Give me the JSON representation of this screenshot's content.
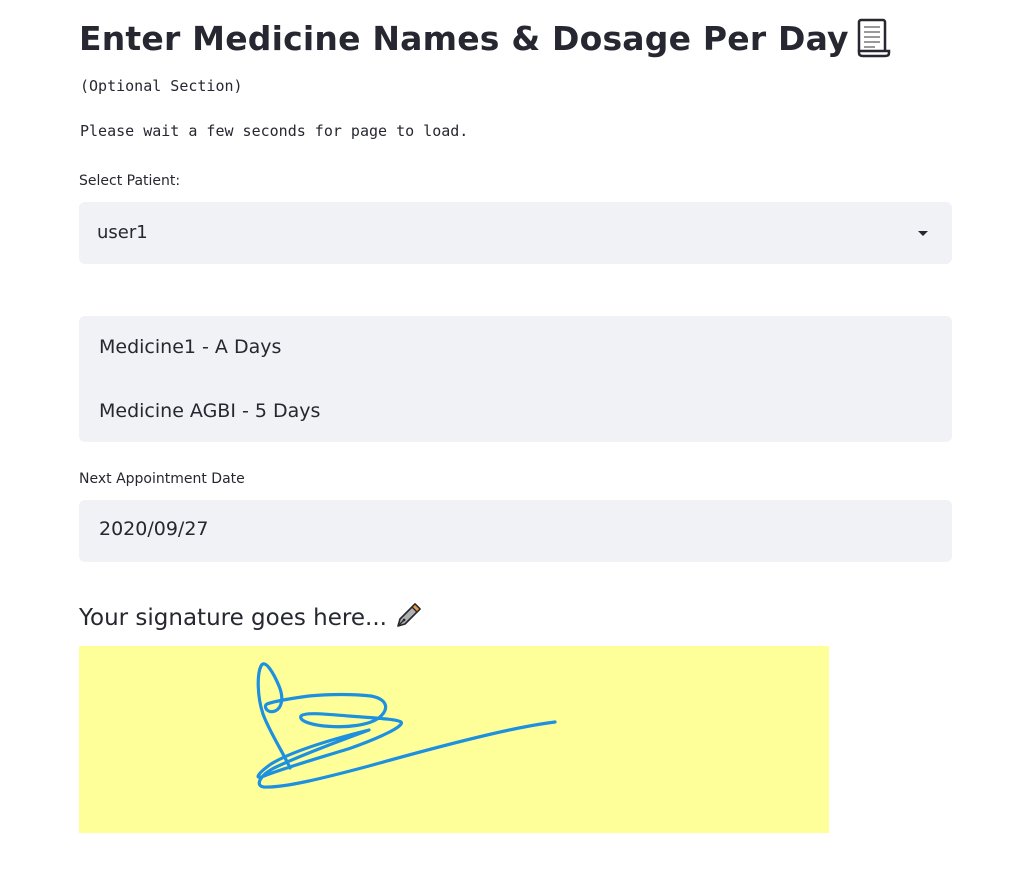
{
  "header": {
    "title": "Enter Medicine Names & Dosage Per Day",
    "title_icon": "scroll-icon"
  },
  "notes": {
    "optional": "(Optional Section)",
    "wait": "Please wait a few seconds for page to load."
  },
  "patient_select": {
    "label": "Select Patient:",
    "value": "user1",
    "icon": "chevron-down-icon"
  },
  "medicines": {
    "lines": [
      "Medicine1 - A Days",
      "Medicine AGBI - 5 Days"
    ]
  },
  "appointment": {
    "label": "Next Appointment Date",
    "value": "2020/09/27"
  },
  "signature": {
    "heading": "Your signature goes here...",
    "heading_icon": "fountain-pen-icon",
    "canvas_color": "#ffff99",
    "stroke_color": "#1e90e0"
  },
  "colors": {
    "input_background": "#f0f2f6",
    "text": "#262730"
  }
}
